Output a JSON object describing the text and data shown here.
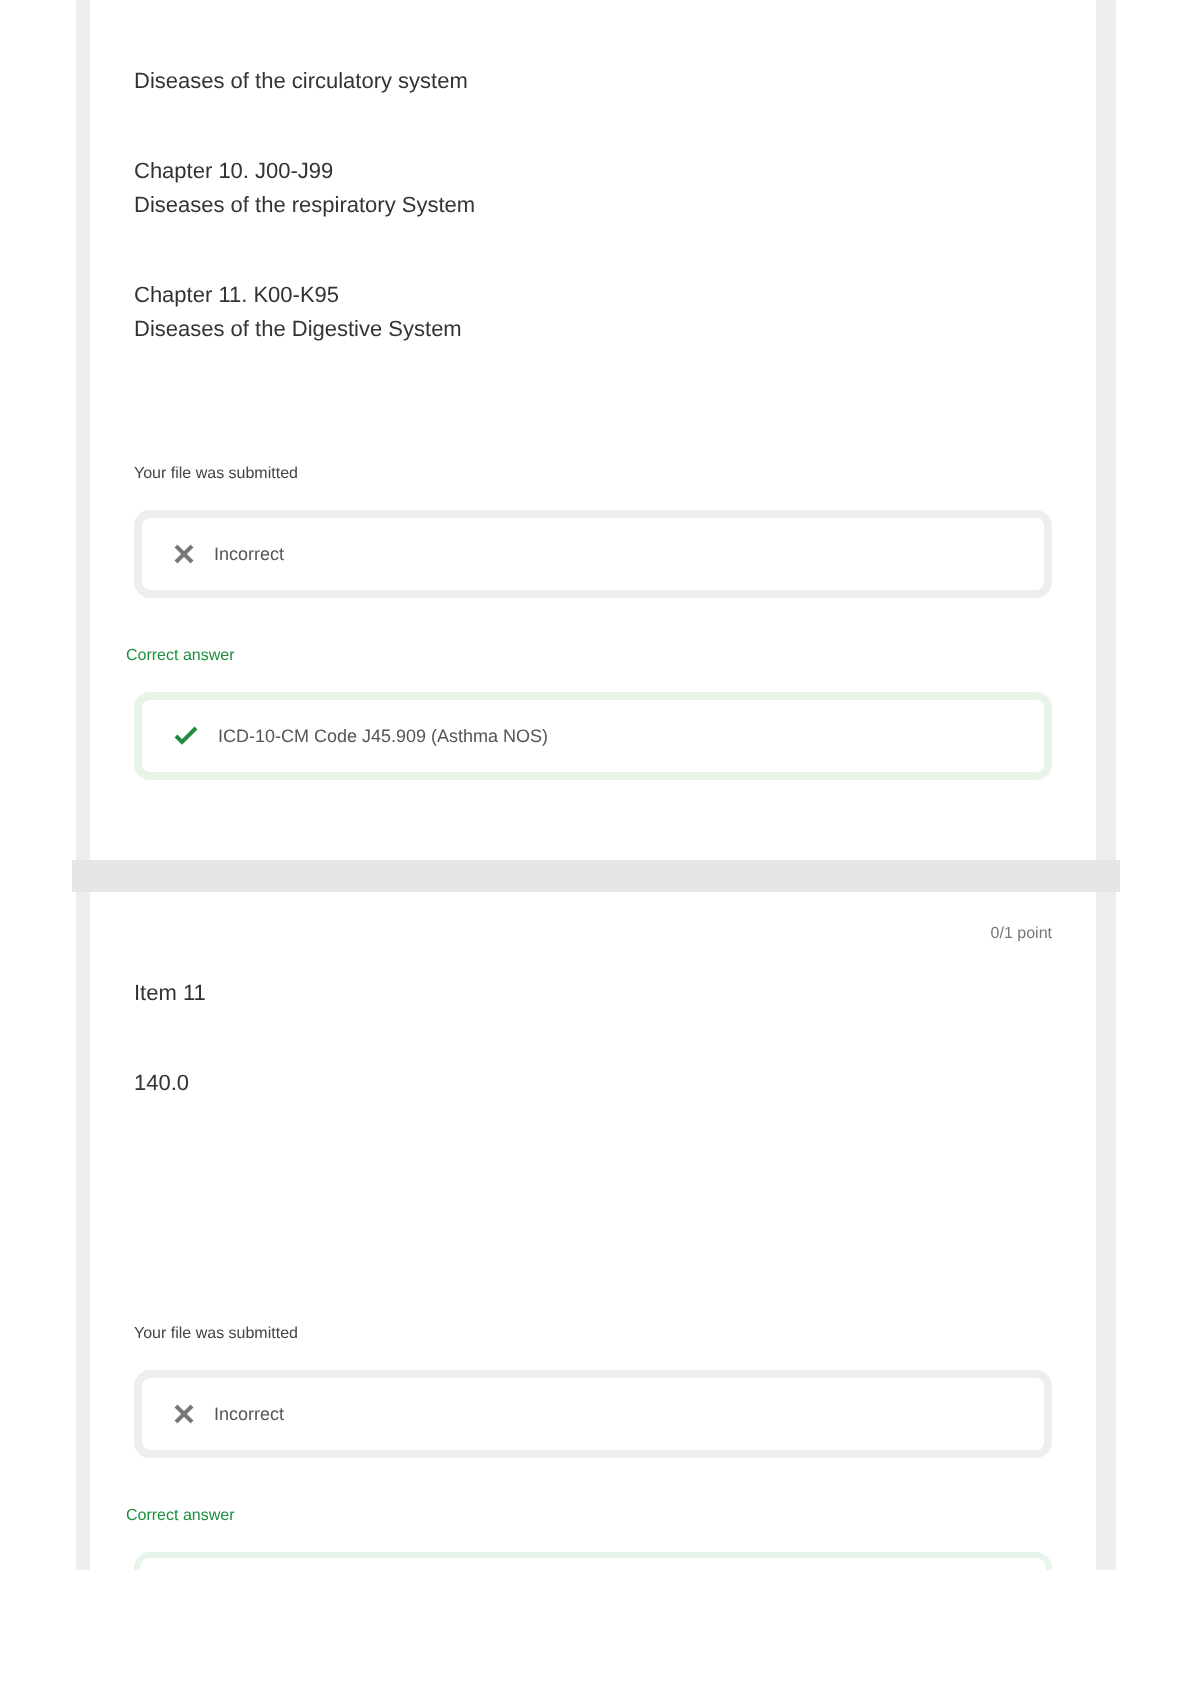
{
  "cards": [
    {
      "lines": [
        {
          "kind": "text",
          "text": "Diseases of the circulatory system"
        },
        {
          "kind": "gap"
        },
        {
          "kind": "text",
          "text": "Chapter 10. J00-J99"
        },
        {
          "kind": "text",
          "text": "Diseases of the respiratory System"
        },
        {
          "kind": "gap"
        },
        {
          "kind": "text",
          "text": "Chapter 11. K00-K95"
        },
        {
          "kind": "text",
          "text": "Diseases of the Digestive System"
        }
      ],
      "answer_label": "Your file was submitted",
      "answer": {
        "value": "Incorrect",
        "correct": false
      },
      "correct_label": "Correct answer",
      "correct_answer": "ICD-10-CM Code J45.909 (Asthma NOS)",
      "correct_visible": true
    },
    {
      "points": "0/1 point",
      "lines": [
        {
          "kind": "text",
          "text": "Item 11"
        },
        {
          "kind": "gap"
        },
        {
          "kind": "text",
          "text": "140.0"
        }
      ],
      "answer_label": "Your file was submitted",
      "answer": {
        "value": "Incorrect",
        "correct": false
      },
      "correct_label": "Correct answer",
      "correct_visible": false
    }
  ]
}
